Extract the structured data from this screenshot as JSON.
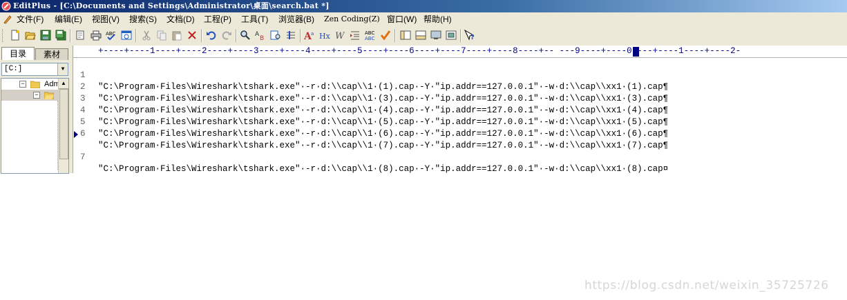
{
  "window": {
    "title": "EditPlus - [C:\\Documents and Settings\\Administrator\\桌面\\search.bat *]"
  },
  "menu": [
    {
      "label": "文件(F)"
    },
    {
      "label": "编辑(E)"
    },
    {
      "label": "视图(V)"
    },
    {
      "label": "搜索(S)"
    },
    {
      "label": "文档(D)"
    },
    {
      "label": "工程(P)"
    },
    {
      "label": "工具(T)"
    },
    {
      "label": "浏览器(B)"
    },
    {
      "label": "Zen Coding(Z)"
    },
    {
      "label": "窗口(W)"
    },
    {
      "label": "帮助(H)"
    }
  ],
  "sidebar": {
    "tabs": [
      {
        "label": "目录",
        "active": true
      },
      {
        "label": "素材",
        "active": false
      }
    ],
    "drive": "[C:]",
    "tree_item": "Adm"
  },
  "ruler": {
    "text": "+----+----1----+----2----+----3----+----4----+----5----+----6----+----7----+----8----+-- ---9----+----0----+----1----+----2-"
  },
  "editor": {
    "current_line": 7,
    "lines": [
      {
        "no": "1",
        "text": "\"C:\\Program·Files\\Wireshark\\tshark.exe\"·-r·d:\\\\cap\\\\1·(1).cap·-Y·\"ip.addr==127.0.0.1\"·-w·d:\\\\cap\\\\xx1·(1).cap¶"
      },
      {
        "no": "2",
        "text": "\"C:\\Program·Files\\Wireshark\\tshark.exe\"·-r·d:\\\\cap\\\\1·(3).cap·-Y·\"ip.addr==127.0.0.1\"·-w·d:\\\\cap\\\\xx1·(3).cap¶"
      },
      {
        "no": "3",
        "text": "\"C:\\Program·Files\\Wireshark\\tshark.exe\"·-r·d:\\\\cap\\\\1·(4).cap·-Y·\"ip.addr==127.0.0.1\"·-w·d:\\\\cap\\\\xx1·(4).cap¶"
      },
      {
        "no": "4",
        "text": "\"C:\\Program·Files\\Wireshark\\tshark.exe\"·-r·d:\\\\cap\\\\1·(5).cap·-Y·\"ip.addr==127.0.0.1\"·-w·d:\\\\cap\\\\xx1·(5).cap¶"
      },
      {
        "no": "5",
        "text": "\"C:\\Program·Files\\Wireshark\\tshark.exe\"·-r·d:\\\\cap\\\\1·(6).cap·-Y·\"ip.addr==127.0.0.1\"·-w·d:\\\\cap\\\\xx1·(6).cap¶"
      },
      {
        "no": "6",
        "text": "\"C:\\Program·Files\\Wireshark\\tshark.exe\"·-r·d:\\\\cap\\\\1·(7).cap·-Y·\"ip.addr==127.0.0.1\"·-w·d:\\\\cap\\\\xx1·(7).cap¶"
      },
      {
        "no": "7",
        "text": "\"C:\\Program·Files\\Wireshark\\tshark.exe\"·-r·d:\\\\cap\\\\1·(8).cap·-Y·\"ip.addr==127.0.0.1\"·-w·d:\\\\cap\\\\xx1·(8).cap¤"
      }
    ]
  },
  "watermark": "https://blog.csdn.net/weixin_35725726",
  "toolbar": {
    "icons": [
      "new-file-icon",
      "open-file-icon",
      "save-icon",
      "save-all-icon",
      "print-preview-icon",
      "print-icon",
      "spell-check-icon",
      "browser-icon",
      "cut-icon",
      "copy-icon",
      "paste-icon",
      "delete-icon",
      "undo-icon",
      "redo-icon",
      "find-icon",
      "replace-icon",
      "find-in-files-icon",
      "goto-line-icon",
      "font-icon",
      "hex-icon",
      "word-wrap-icon",
      "indent-icon",
      "spell-check-abc-icon",
      "check-mark-icon",
      "toggle-sidebar-icon",
      "toggle-output-icon",
      "screen-icon",
      "full-screen-icon",
      "help-icon"
    ]
  },
  "colors": {
    "title_bar_start": "#0a246a",
    "title_bar_end": "#a6caf0",
    "chrome": "#ece9d8",
    "ruler_text": "#000080"
  }
}
